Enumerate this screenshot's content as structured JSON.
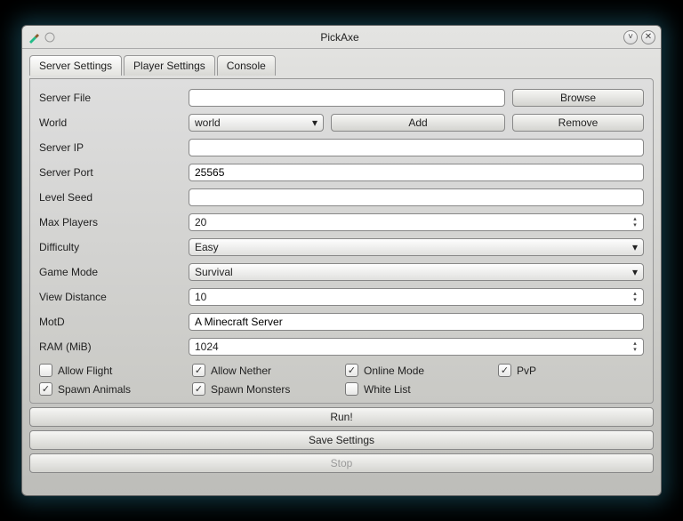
{
  "window": {
    "title": "PickAxe"
  },
  "tabs": [
    {
      "label": "Server Settings",
      "active": true
    },
    {
      "label": "Player Settings",
      "active": false
    },
    {
      "label": "Console",
      "active": false
    }
  ],
  "fields": {
    "server_file": {
      "label": "Server File",
      "value": ""
    },
    "world": {
      "label": "World",
      "selected": "world"
    },
    "server_ip": {
      "label": "Server IP",
      "value": ""
    },
    "server_port": {
      "label": "Server Port",
      "value": "25565"
    },
    "level_seed": {
      "label": "Level Seed",
      "value": ""
    },
    "max_players": {
      "label": "Max Players",
      "value": "20"
    },
    "difficulty": {
      "label": "Difficulty",
      "selected": "Easy"
    },
    "game_mode": {
      "label": "Game Mode",
      "selected": "Survival"
    },
    "view_distance": {
      "label": "View Distance",
      "value": "10"
    },
    "motd": {
      "label": "MotD",
      "value": "A Minecraft Server"
    },
    "ram": {
      "label": "RAM (MiB)",
      "value": "1024"
    }
  },
  "buttons": {
    "browse": "Browse",
    "add": "Add",
    "remove": "Remove",
    "run": "Run!",
    "save": "Save Settings",
    "stop": "Stop"
  },
  "checks": {
    "allow_flight": {
      "label": "Allow Flight",
      "checked": false
    },
    "allow_nether": {
      "label": "Allow Nether",
      "checked": true
    },
    "online_mode": {
      "label": "Online Mode",
      "checked": true
    },
    "pvp": {
      "label": "PvP",
      "checked": true
    },
    "spawn_animals": {
      "label": "Spawn Animals",
      "checked": true
    },
    "spawn_monsters": {
      "label": "Spawn Monsters",
      "checked": true
    },
    "white_list": {
      "label": "White List",
      "checked": false
    }
  }
}
